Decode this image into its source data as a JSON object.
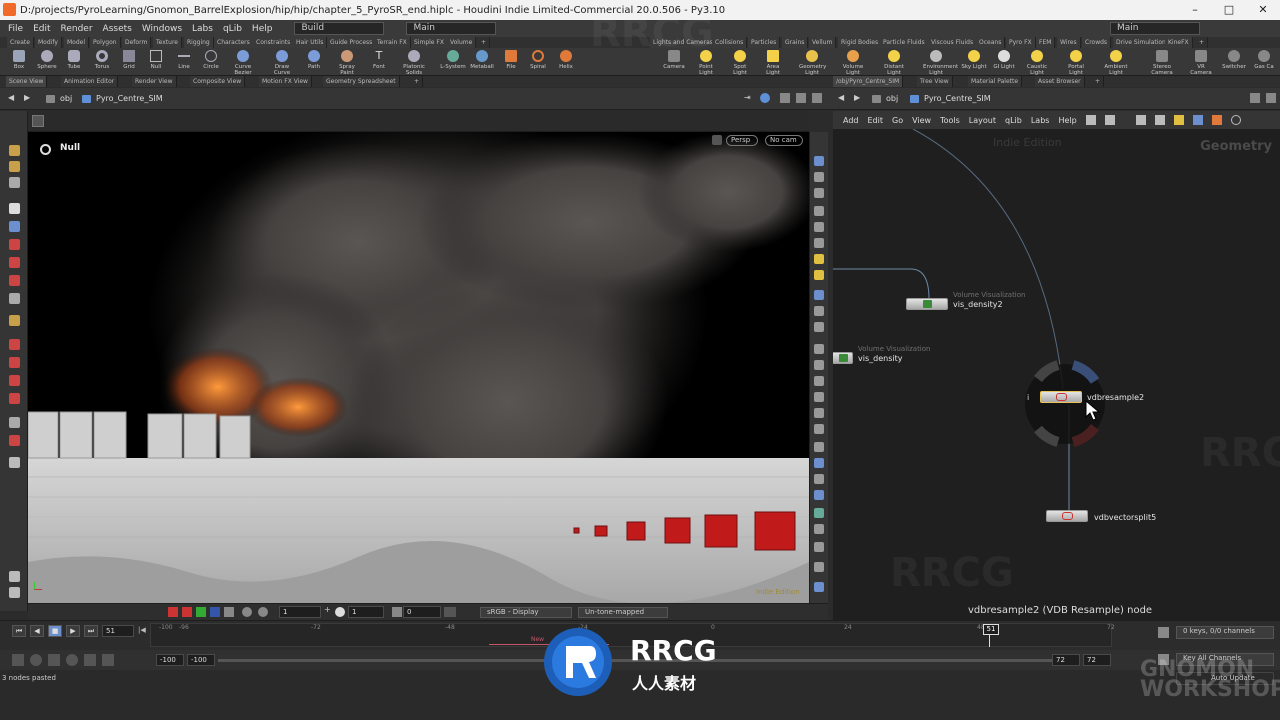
{
  "titlebar": {
    "text": "D:/projects/PyroLearning/Gnomon_BarrelExplosion/hip/hip/chapter_5_PyroSR_end.hiplc - Houdini Indie Limited-Commercial 20.0.506 - Py3.10"
  },
  "menubar": {
    "items": [
      "File",
      "Edit",
      "Render",
      "Assets",
      "Windows",
      "Labs",
      "qLib",
      "Help"
    ],
    "desktop": "Build",
    "desktop_right": "Main",
    "main": "Main"
  },
  "shelf_tabs_left": [
    "Create",
    "Modify",
    "Model",
    "Polygon",
    "Deform",
    "Texture",
    "Rigging",
    "Characters",
    "Constraints",
    "Hair Utils",
    "Guide Process",
    "Terrain FX",
    "Simple FX",
    "Volume"
  ],
  "shelf_tabs_right": [
    "Lights and Cameras",
    "Collisions",
    "Particles",
    "Grains",
    "Vellum",
    "Rigid Bodies",
    "Particle Fluids",
    "Viscous Fluids",
    "Oceans",
    "Pyro FX",
    "FEM",
    "Wires",
    "Crowds",
    "Drive Simulation",
    "KineFX"
  ],
  "tools_left": [
    "Box",
    "Sphere",
    "Tube",
    "Torus",
    "Grid",
    "Null",
    "Line",
    "Circle",
    "Curve Bezier",
    "Draw Curve",
    "Path",
    "Spray Paint",
    "Font",
    "Platonic Solids",
    "L-System",
    "Metaball",
    "File",
    "Spiral",
    "Helix"
  ],
  "tools_right": [
    "Camera",
    "Point Light",
    "Spot Light",
    "Area Light",
    "Geometry Light",
    "Volume Light",
    "Distant Light",
    "Environment Light",
    "Sky Light",
    "GI Light",
    "Caustic Light",
    "Portal Light",
    "Ambient Light",
    "Stereo Camera",
    "VR Camera",
    "Switcher",
    "Gas Ca"
  ],
  "left_pane_tabs": [
    "Scene View",
    "Animation Editor",
    "Render View",
    "Composite View",
    "Motion FX View",
    "Geometry Spreadsheet"
  ],
  "right_pane_tabs": [
    "/obj/Pyro_Centre_SIM",
    "Tree View",
    "Material Palette",
    "Asset Browser"
  ],
  "path": {
    "root": "obj",
    "node": "Pyro_Centre_SIM"
  },
  "viewport": {
    "selected": "Null",
    "persp": "Persp",
    "cam": "No cam",
    "edition": "Indie Edition"
  },
  "viewport_bottom": {
    "field1": "1",
    "field2": "1",
    "field3": "0",
    "display": "sRGB - Display",
    "tonemap": "Un-tone-mapped"
  },
  "network_menu": [
    "Add",
    "Edit",
    "Go",
    "View",
    "Tools",
    "Layout",
    "qLib",
    "Labs",
    "Help"
  ],
  "network": {
    "watermark": "Indie Edition",
    "context": "Geometry",
    "node_vis2_type": "Volume Visualization",
    "node_vis2_name": "vis_density2",
    "node_vis_type": "Volume Visualization",
    "node_vis_name": "vis_density",
    "node_resample_name": "vdbresample2",
    "node_split_name": "vdbvectorsplit5",
    "info_label": "i",
    "footer": "vdbresample2 (VDB Resample) node"
  },
  "timeline": {
    "ticks": [
      "-100",
      "-96",
      "-72",
      "-48",
      "-24",
      "0",
      "24",
      "48",
      "72"
    ],
    "current": "51",
    "frame_field": "51",
    "start": "-100",
    "start2": "-100",
    "end": "72",
    "end2": "72",
    "new_marker": "New"
  },
  "right_controls": {
    "keys": "0 keys, 0/0 channels",
    "key_all": "Key All Channels",
    "auto_update": "Auto Update"
  },
  "status": {
    "text": "3 nodes pasted"
  },
  "branding": {
    "logo_text": "RRCG",
    "logo_sub": "人人素材",
    "watermark": "RRCG",
    "workshop": "GNOMON WORKSHOP"
  },
  "colors": {
    "accent": "#f06a2a",
    "node_blue": "#5f8fd6",
    "wire": "#6e8aa8"
  }
}
